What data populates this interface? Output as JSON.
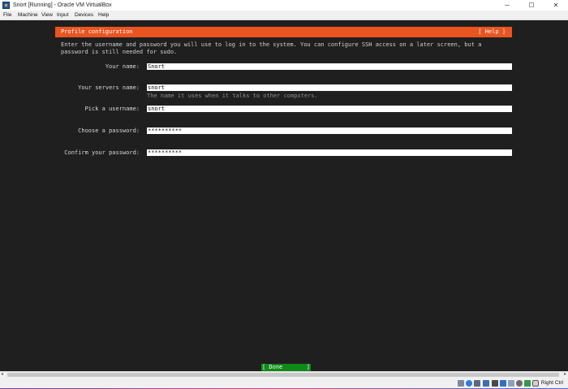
{
  "window": {
    "title": "Snort  [Running] - Oracle VM VirtualBox",
    "minimize_glyph": "─",
    "maximize_glyph": "☐",
    "close_glyph": "✕"
  },
  "menubar": {
    "items": [
      "File",
      "Machine",
      "View",
      "Input",
      "Devices",
      "Help"
    ]
  },
  "installer": {
    "header_title": "Profile configuration",
    "help_label": "[ Help ]",
    "intro_line1": "Enter the username and password you will use to log in to the system. You can configure SSH access on a later screen, but a",
    "intro_line2": "password is still needed for sudo.",
    "fields": [
      {
        "label": "Your name:",
        "value": "Snort"
      },
      {
        "label": "Your servers name:",
        "value": "snort"
      },
      {
        "label": "Pick a username:",
        "value": "snort"
      },
      {
        "label": "Choose a password:",
        "value": "**********"
      },
      {
        "label": "Confirm your password:",
        "value": "**********"
      }
    ],
    "server_name_hint": "The name it uses when it talks to other computers.",
    "done_label": "[ Done       ]",
    "accent_color": "#e95420",
    "done_color": "#0f8a19"
  },
  "statusbar": {
    "icons": [
      "hard-disk-icon",
      "optical-disk-icon",
      "audio-icon",
      "network-icon",
      "usb-icon",
      "shared-folders-icon",
      "display-icon",
      "recording-icon",
      "cpu-icon",
      "mouse-integration-icon",
      "host-key-arrow-icon"
    ],
    "host_key": "Right Ctrl"
  }
}
